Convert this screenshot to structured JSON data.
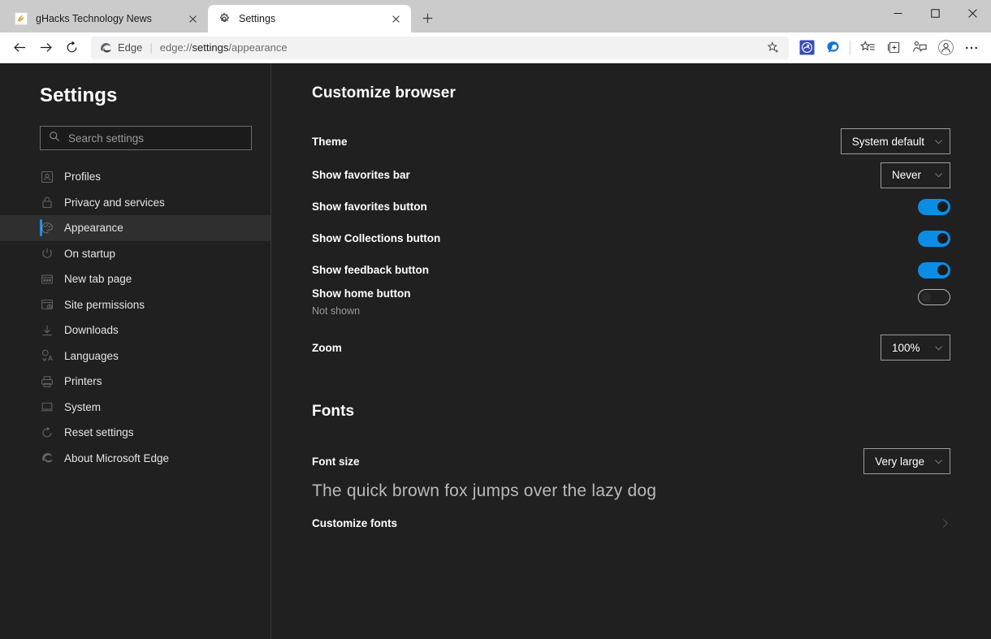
{
  "window": {
    "controls": [
      {
        "name": "minimize",
        "glyph": "—"
      },
      {
        "name": "maximize",
        "glyph": "□"
      },
      {
        "name": "close",
        "glyph": "✕"
      }
    ]
  },
  "tabs": [
    {
      "title": "gHacks Technology News",
      "favicon": "ghacks-favicon",
      "active": false,
      "close_glyph": "✕"
    },
    {
      "title": "Settings",
      "favicon": "gear-icon",
      "active": true,
      "close_glyph": "✕"
    }
  ],
  "new_tab_label": "+",
  "toolbar": {
    "back_label": "←",
    "forward_label": "→",
    "refresh_label": "↻",
    "brand": "Edge",
    "separator": "|",
    "url_prefix": "edge://",
    "url_emphasis": "settings",
    "url_suffix": "/appearance",
    "url_full": "edge://settings/appearance",
    "icons": [
      "add-favorite-star-icon",
      "extension-icon",
      "edge-copilot-icon",
      "favorites-list-icon",
      "collections-icon",
      "feedback-icon",
      "profile-icon",
      "more-options-icon"
    ]
  },
  "sidebar": {
    "title": "Settings",
    "search": {
      "placeholder": "Search settings",
      "value": "",
      "icon": "search-icon"
    },
    "items": [
      {
        "label": "Profiles",
        "icon": "profile-icon",
        "selected": false
      },
      {
        "label": "Privacy and services",
        "icon": "lock-icon",
        "selected": false
      },
      {
        "label": "Appearance",
        "icon": "palette-icon",
        "selected": true
      },
      {
        "label": "On startup",
        "icon": "power-icon",
        "selected": false
      },
      {
        "label": "New tab page",
        "icon": "new-tab-icon",
        "selected": false
      },
      {
        "label": "Site permissions",
        "icon": "site-permissions-icon",
        "selected": false
      },
      {
        "label": "Downloads",
        "icon": "download-icon",
        "selected": false
      },
      {
        "label": "Languages",
        "icon": "languages-icon",
        "selected": false
      },
      {
        "label": "Printers",
        "icon": "printer-icon",
        "selected": false
      },
      {
        "label": "System",
        "icon": "system-icon",
        "selected": false
      },
      {
        "label": "Reset settings",
        "icon": "reset-icon",
        "selected": false
      },
      {
        "label": "About Microsoft Edge",
        "icon": "edge-icon",
        "selected": false
      }
    ],
    "accent_color": "#1b8fe3"
  },
  "main": {
    "customize_browser": {
      "heading": "Customize browser",
      "theme": {
        "label": "Theme",
        "value": "System default",
        "control": "dropdown"
      },
      "favorites_bar": {
        "label": "Show favorites bar",
        "value": "Never",
        "control": "dropdown"
      },
      "favorites_button": {
        "label": "Show favorites button",
        "value": "on",
        "control": "toggle"
      },
      "collections_button": {
        "label": "Show Collections button",
        "value": "on",
        "control": "toggle"
      },
      "feedback_button": {
        "label": "Show feedback button",
        "value": "on",
        "control": "toggle"
      },
      "home_button": {
        "label": "Show home button",
        "sublabel": "Not shown",
        "value": "off",
        "control": "toggle"
      },
      "zoom": {
        "label": "Zoom",
        "value": "100%",
        "control": "dropdown"
      }
    },
    "fonts": {
      "heading": "Fonts",
      "font_size": {
        "label": "Font size",
        "value": "Very large",
        "control": "dropdown"
      },
      "sample_text": "The quick brown fox jumps over the lazy dog",
      "customize_fonts": {
        "label": "Customize fonts",
        "chevron": "chevron-right-icon"
      }
    }
  },
  "colors": {
    "toggle_on": "#0d8ce5",
    "page_background": "#202020",
    "selected_row": "#2f2f2f"
  }
}
